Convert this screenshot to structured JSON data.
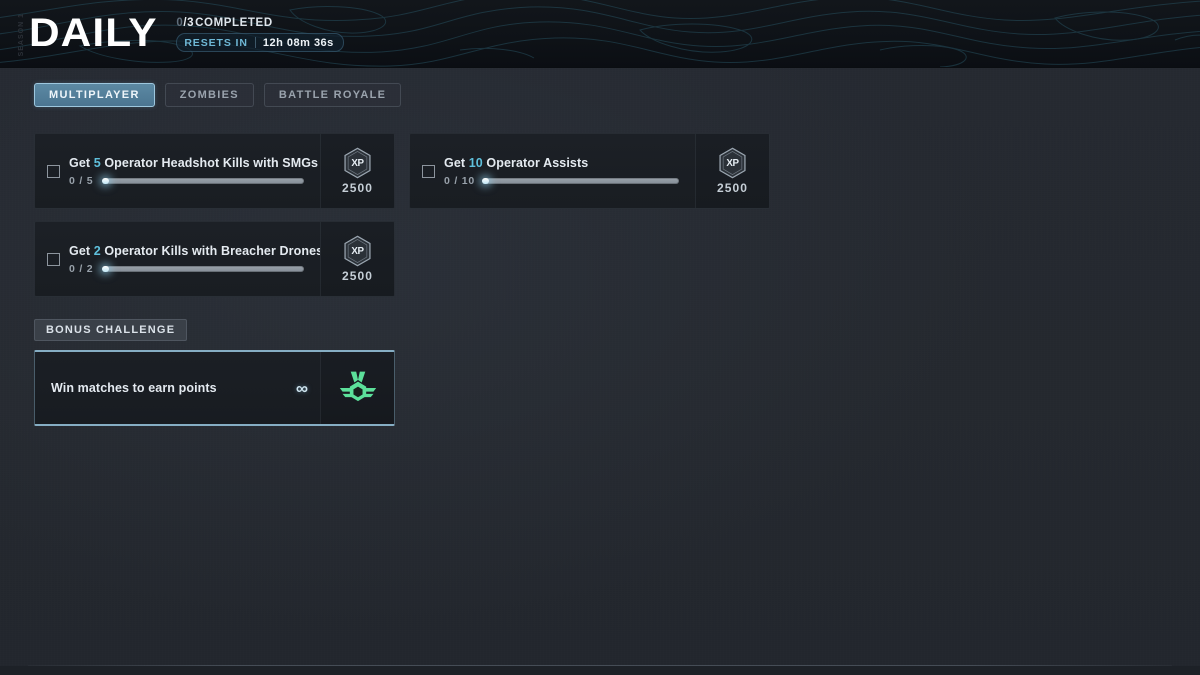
{
  "header": {
    "side_label": "SEASON 1",
    "title": "DAILY",
    "completed_done": "0",
    "completed_sep": "/",
    "completed_total": "3",
    "completed_label": "COMPLETED",
    "resets_label": "RESETS IN",
    "resets_time": "12h 08m 36s"
  },
  "tabs": [
    {
      "label": "MULTIPLAYER",
      "active": true
    },
    {
      "label": "ZOMBIES",
      "active": false
    },
    {
      "label": "BATTLE ROYALE",
      "active": false
    }
  ],
  "challenges": [
    {
      "title_prefix": "Get ",
      "title_highlight": "5",
      "title_suffix": " Operator Headshot Kills with SMGs",
      "progress_text": "0 / 5",
      "progress_percent": 0,
      "reward_amount": "2500",
      "reward_icon": "xp-hex-icon",
      "checked": false
    },
    {
      "title_prefix": "Get ",
      "title_highlight": "10",
      "title_suffix": " Operator Assists",
      "progress_text": "0 / 10",
      "progress_percent": 0,
      "reward_amount": "2500",
      "reward_icon": "xp-hex-icon",
      "checked": false
    },
    {
      "title_prefix": "Get ",
      "title_highlight": "2",
      "title_suffix": " Operator Kills with Breacher Drones",
      "progress_text": "0 / 2",
      "progress_percent": 0,
      "reward_amount": "2500",
      "reward_icon": "xp-hex-icon",
      "checked": false
    }
  ],
  "bonus": {
    "section_label": "BONUS CHALLENGE",
    "title": "Win matches to earn points",
    "repeat_symbol": "∞",
    "reward_icon": "medal-icon"
  },
  "colors": {
    "accent_cyan": "#5fc0dc",
    "tab_active": "#5c89a3",
    "bonus_border": "#86aec4",
    "medal_green": "#5ce09a",
    "background": "#25292f",
    "header_bg": "#0e1217"
  },
  "xp_badge_text": "XP"
}
